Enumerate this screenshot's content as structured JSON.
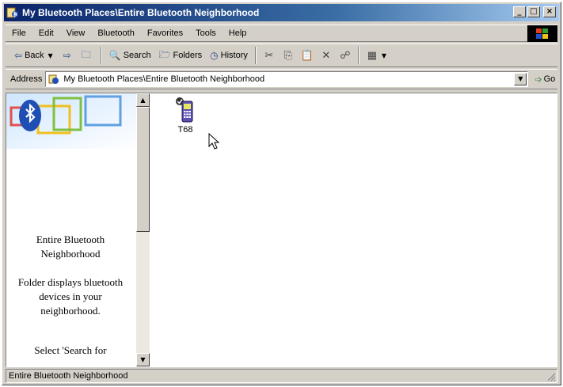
{
  "window": {
    "title": "My Bluetooth Places\\Entire Bluetooth Neighborhood",
    "minimize": "_",
    "maximize": "□",
    "close": "×"
  },
  "menu": [
    "File",
    "Edit",
    "View",
    "Bluetooth",
    "Favorites",
    "Tools",
    "Help"
  ],
  "toolbar": {
    "back_label": "Back",
    "search_label": "Search",
    "folders_label": "Folders",
    "history_label": "History"
  },
  "address": {
    "label": "Address",
    "value": "My Bluetooth Places\\Entire Bluetooth Neighborhood",
    "go_label": "Go"
  },
  "left_pane": {
    "title": "Entire Bluetooth Neighborhood",
    "description": "Folder displays bluetooth devices in your neighborhood.",
    "more_text": "Select 'Search for"
  },
  "files": [
    {
      "label": "T68",
      "icon": "mobile-phone-icon"
    }
  ],
  "status": {
    "text": "Entire Bluetooth Neighborhood"
  },
  "colors": {
    "title_bar_start": "#0a246a",
    "title_bar_end": "#a6caf0",
    "chrome": "#d4d0c8",
    "bluetooth_blue": "#1f4fb5"
  }
}
